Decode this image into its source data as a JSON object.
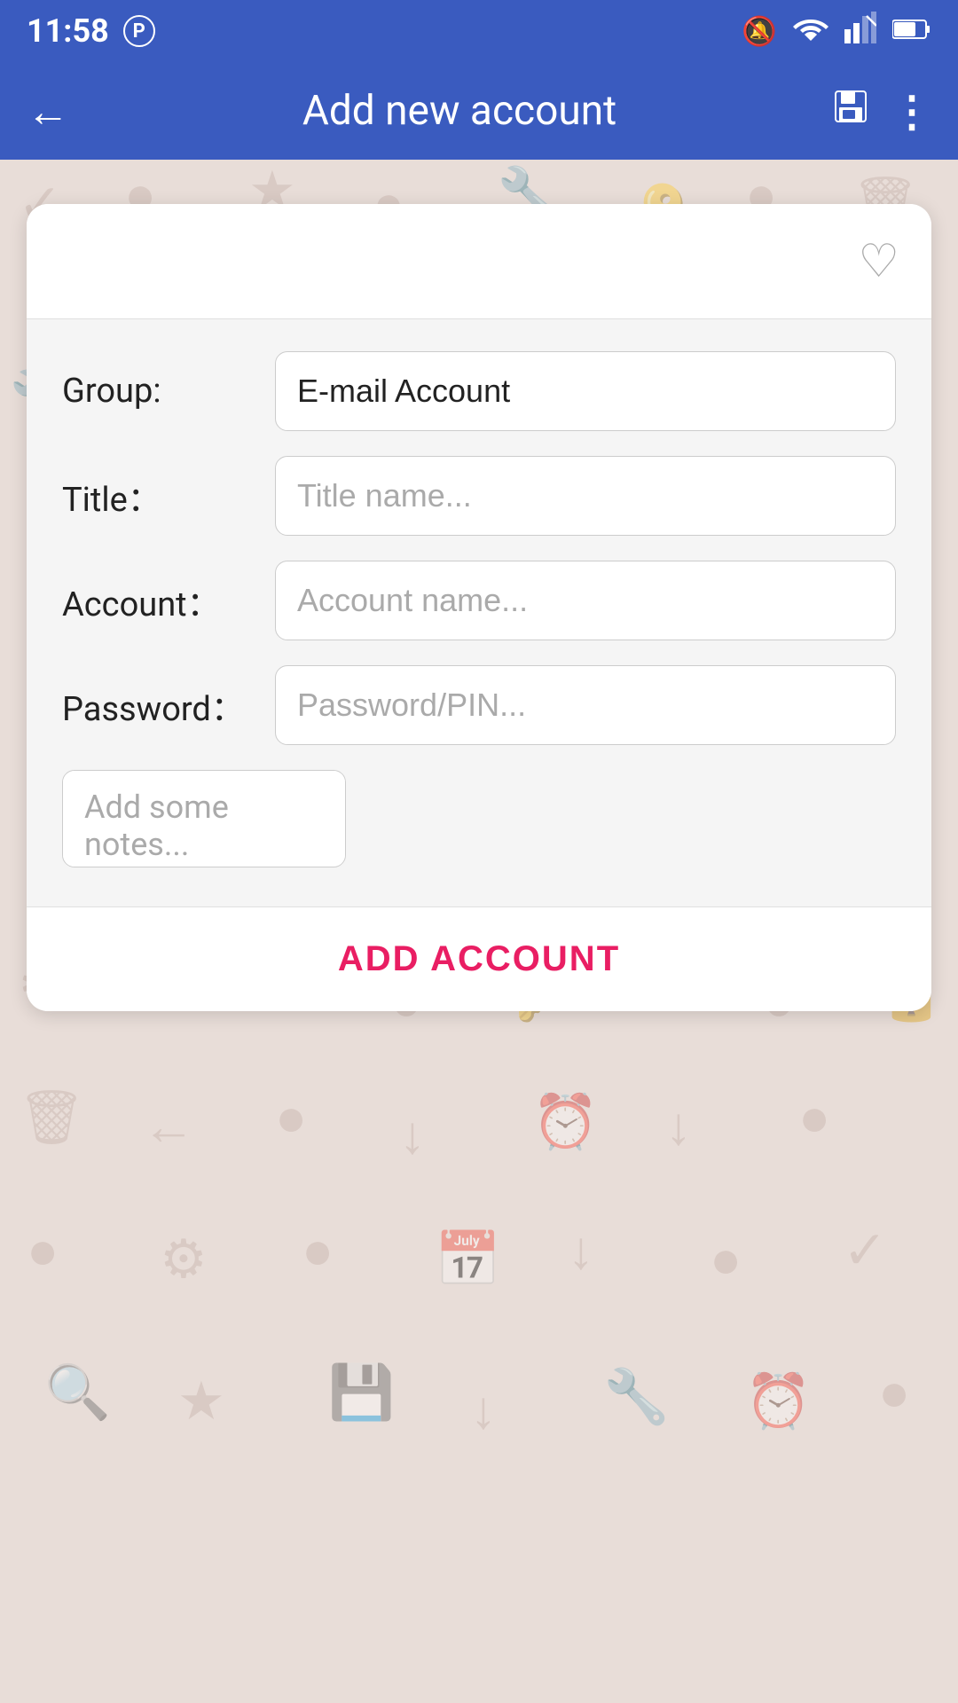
{
  "status_bar": {
    "time": "11:58",
    "icons": [
      "mute-icon",
      "wifi-icon",
      "signal-icon",
      "battery-icon"
    ]
  },
  "app_bar": {
    "title": "Add new account",
    "back_label": "←",
    "save_label": "💾",
    "more_label": "⋮"
  },
  "form": {
    "favorite_label": "♡",
    "group_label": "Group:",
    "group_value": "E-mail Account",
    "title_label": "Title：",
    "title_placeholder": "Title name...",
    "account_label": "Account：",
    "account_placeholder": "Account name...",
    "password_label": "Password：",
    "password_placeholder": "Password/PIN...",
    "notes_placeholder": "Add some notes...",
    "add_button_label": "ADD ACCOUNT"
  }
}
